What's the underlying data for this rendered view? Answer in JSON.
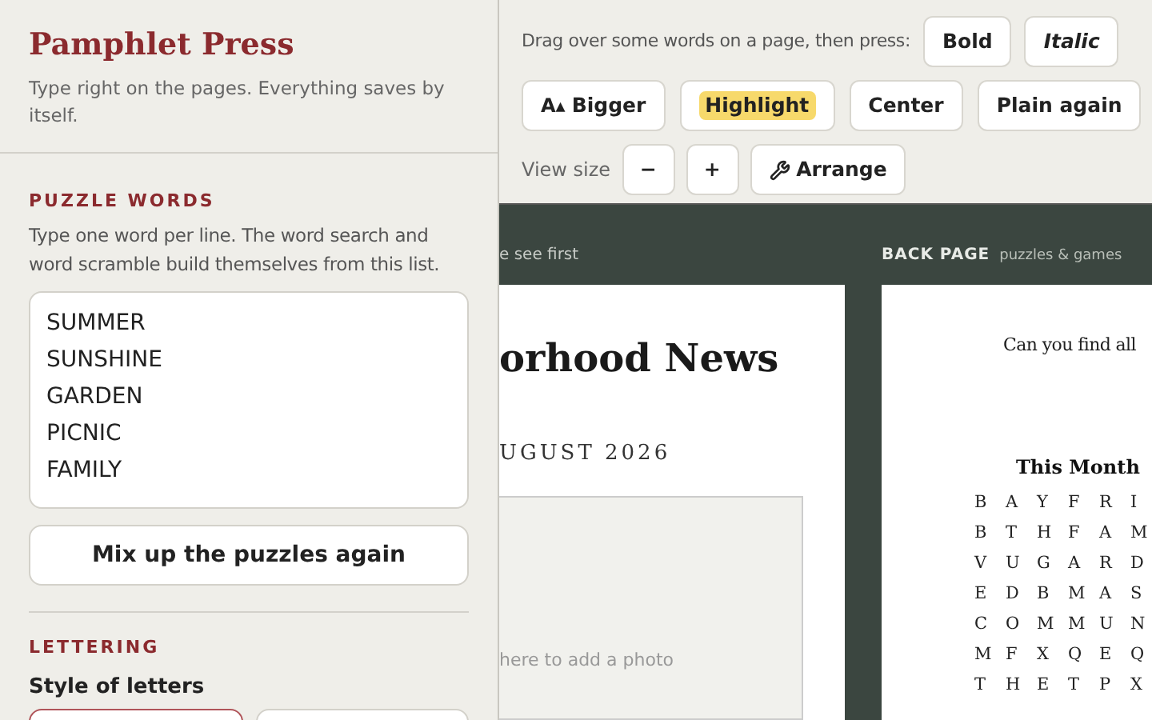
{
  "sidebar": {
    "title": "Pamphlet Press",
    "subtitle": "Type right on the pages. Everything saves by itself.",
    "puzzle_words": {
      "heading": "PUZZLE WORDS",
      "description": "Type one word per line. The word search and word scramble build themselves from this list.",
      "words": [
        "SUMMER",
        "SUNSHINE",
        "GARDEN",
        "PICNIC",
        "FAMILY"
      ],
      "button": "Mix up the puzzles again"
    },
    "lettering": {
      "heading": "LETTERING",
      "label": "Style of letters",
      "styles": [
        {
          "selected": true
        },
        {
          "selected": false
        }
      ]
    }
  },
  "toolbar": {
    "hint": "Drag over some words on a page, then press:",
    "format_buttons": [
      {
        "kind": "bold",
        "label": "Bold"
      },
      {
        "kind": "italic",
        "label": "Italic"
      },
      {
        "kind": "bigger",
        "icon": "A▴",
        "label": "Bigger"
      },
      {
        "kind": "highlight",
        "label": "Highlight"
      },
      {
        "kind": "plain",
        "label": "Center"
      },
      {
        "kind": "plain",
        "label": "Plain again"
      }
    ],
    "view_size_label": "View size",
    "zoom_out": "−",
    "zoom_in": "+",
    "arrange": "Arrange"
  },
  "front_page": {
    "caption": "e see first",
    "title": "orhood News",
    "date": "UGUST 2026",
    "photo_hint": "here to add a photo"
  },
  "back_page": {
    "caption_bold": "BACK PAGE",
    "caption": "puzzles & games",
    "intro": "Can you find all",
    "grid_title": "This Month",
    "grid": [
      [
        "B",
        "A",
        "Y",
        "F",
        "R",
        "I"
      ],
      [
        "B",
        "T",
        "H",
        "F",
        "A",
        "M"
      ],
      [
        "V",
        "U",
        "G",
        "A",
        "R",
        "D"
      ],
      [
        "E",
        "D",
        "B",
        "M",
        "A",
        "S"
      ],
      [
        "C",
        "O",
        "M",
        "M",
        "U",
        "N"
      ],
      [
        "M",
        "F",
        "X",
        "Q",
        "E",
        "Q"
      ],
      [
        "T",
        "H",
        "E",
        "T",
        "P",
        "X"
      ]
    ]
  }
}
